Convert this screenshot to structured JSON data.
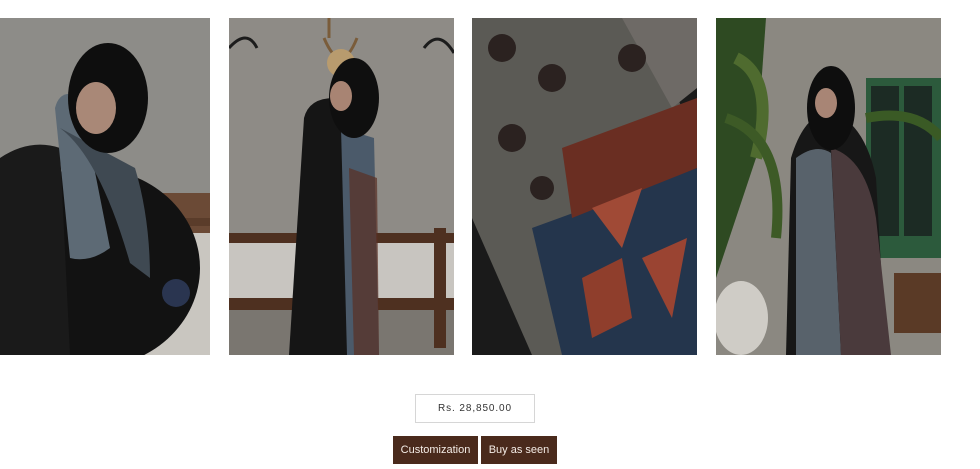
{
  "gallery": {
    "images": [
      {
        "icon": "woman-seated-black-dress-shawl-photo"
      },
      {
        "icon": "woman-standing-chandelier-photo"
      },
      {
        "icon": "shawl-fabric-closeup-photo"
      },
      {
        "icon": "woman-shawl-plants-photo"
      }
    ]
  },
  "product": {
    "price": "Rs. 28,850.00"
  },
  "actions": {
    "customization_label": "Customization",
    "buy_label": "Buy as seen"
  },
  "colors": {
    "button_bg": "#4a2a1c",
    "button_text": "#f4ece6",
    "price_border": "#d6d6d6"
  }
}
